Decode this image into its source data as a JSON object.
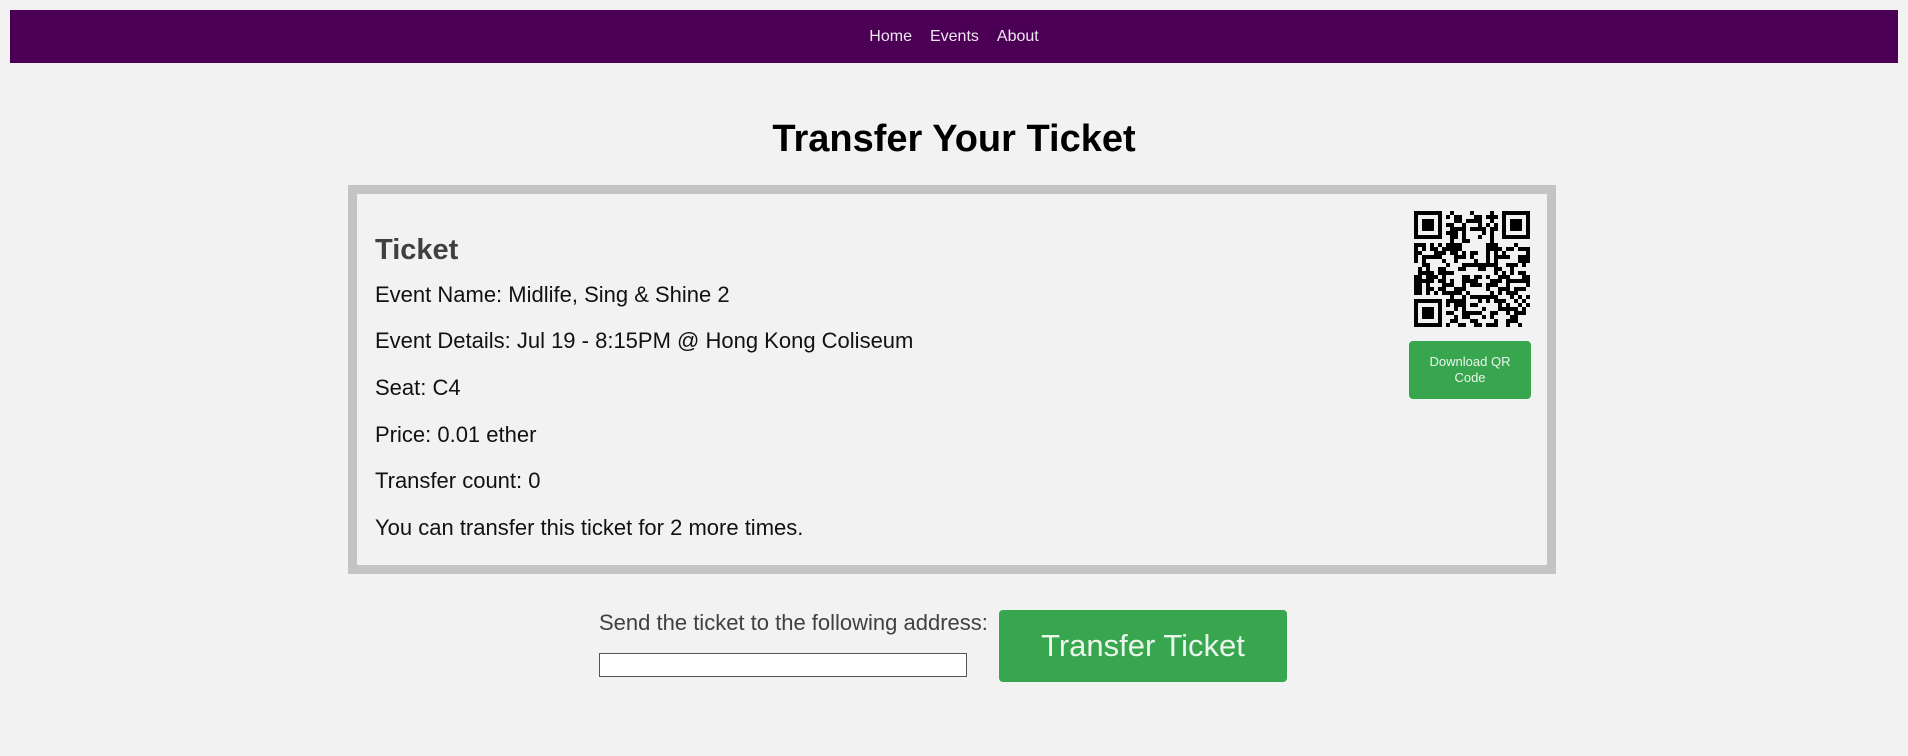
{
  "nav": {
    "items": [
      {
        "label": "Home"
      },
      {
        "label": "Events"
      },
      {
        "label": "About"
      }
    ]
  },
  "page": {
    "title": "Transfer Your Ticket"
  },
  "ticket": {
    "heading": "Ticket",
    "event_name": "Event Name: Midlife, Sing & Shine 2",
    "event_details": "Event Details: Jul 19 - 8:15PM @ Hong Kong Coliseum",
    "seat": "Seat: C4",
    "price": "Price: 0.01 ether",
    "transfer_count": "Transfer count: 0",
    "remaining": "You can transfer this ticket for 2 more times.",
    "qr_icon": "qr-code-icon",
    "download_label": "Download QR Code"
  },
  "transfer": {
    "label": "Send the ticket to the following address:",
    "address_value": "",
    "button_label": "Transfer Ticket"
  },
  "colors": {
    "navbar": "#4b0055",
    "accent_green": "#38a64e",
    "card_border": "#c4c4c4",
    "background": "#f2f2f2"
  }
}
